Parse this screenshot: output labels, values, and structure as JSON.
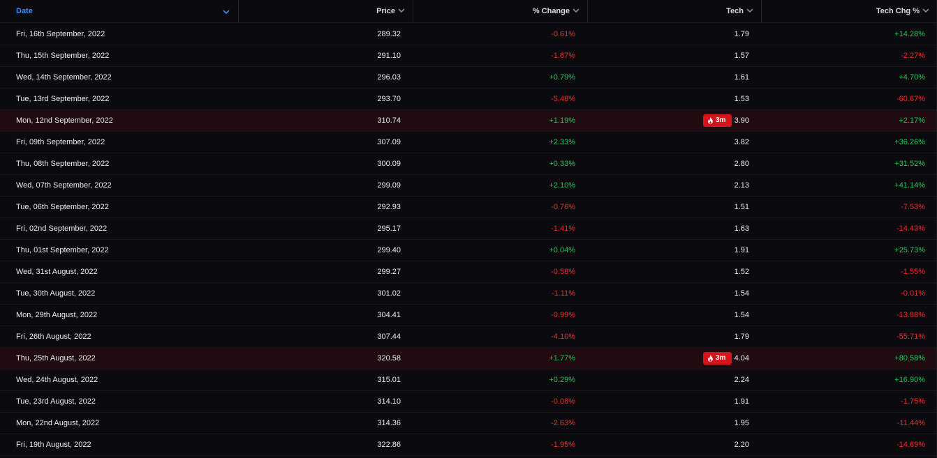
{
  "header": {
    "columns": [
      {
        "label": "Date",
        "active": true
      },
      {
        "label": "Price",
        "active": false
      },
      {
        "label": "% Change",
        "active": false
      },
      {
        "label": "Tech",
        "active": false
      },
      {
        "label": "Tech Chg %",
        "active": false
      }
    ]
  },
  "colors": {
    "positive": "#22c55e",
    "negative": "#ef2b2b",
    "badge": "#d7141b",
    "active_header": "#3b8ef0",
    "highlight_row": "#1f0b10"
  },
  "rows": [
    {
      "date": "Fri, 16th September, 2022",
      "price": "289.32",
      "change": "-0.61%",
      "tech": "1.79",
      "tech_chg": "+14.28%"
    },
    {
      "date": "Thu, 15th September, 2022",
      "price": "291.10",
      "change": "-1.67%",
      "tech": "1.57",
      "tech_chg": "-2.27%"
    },
    {
      "date": "Wed, 14th September, 2022",
      "price": "296.03",
      "change": "+0.79%",
      "tech": "1.61",
      "tech_chg": "+4.70%"
    },
    {
      "date": "Tue, 13rd September, 2022",
      "price": "293.70",
      "change": "-5.48%",
      "tech": "1.53",
      "tech_chg": "-60.67%"
    },
    {
      "date": "Mon, 12nd September, 2022",
      "price": "310.74",
      "change": "+1.19%",
      "tech": "3.90",
      "tech_chg": "+2.17%",
      "badge": "3m",
      "badge_icon": "fire-icon",
      "highlight": true
    },
    {
      "date": "Fri, 09th September, 2022",
      "price": "307.09",
      "change": "+2.33%",
      "tech": "3.82",
      "tech_chg": "+36.26%"
    },
    {
      "date": "Thu, 08th September, 2022",
      "price": "300.09",
      "change": "+0.33%",
      "tech": "2.80",
      "tech_chg": "+31.52%"
    },
    {
      "date": "Wed, 07th September, 2022",
      "price": "299.09",
      "change": "+2.10%",
      "tech": "2.13",
      "tech_chg": "+41.14%"
    },
    {
      "date": "Tue, 06th September, 2022",
      "price": "292.93",
      "change": "-0.76%",
      "tech": "1.51",
      "tech_chg": "-7.53%"
    },
    {
      "date": "Fri, 02nd September, 2022",
      "price": "295.17",
      "change": "-1.41%",
      "tech": "1.63",
      "tech_chg": "-14.43%"
    },
    {
      "date": "Thu, 01st September, 2022",
      "price": "299.40",
      "change": "+0.04%",
      "tech": "1.91",
      "tech_chg": "+25.73%"
    },
    {
      "date": "Wed, 31st August, 2022",
      "price": "299.27",
      "change": "-0.58%",
      "tech": "1.52",
      "tech_chg": "-1.55%"
    },
    {
      "date": "Tue, 30th August, 2022",
      "price": "301.02",
      "change": "-1.11%",
      "tech": "1.54",
      "tech_chg": "-0.01%"
    },
    {
      "date": "Mon, 29th August, 2022",
      "price": "304.41",
      "change": "-0.99%",
      "tech": "1.54",
      "tech_chg": "-13.88%"
    },
    {
      "date": "Fri, 26th August, 2022",
      "price": "307.44",
      "change": "-4.10%",
      "tech": "1.79",
      "tech_chg": "-55.71%"
    },
    {
      "date": "Thu, 25th August, 2022",
      "price": "320.58",
      "change": "+1.77%",
      "tech": "4.04",
      "tech_chg": "+80.58%",
      "badge": "3m",
      "badge_icon": "fire-icon",
      "highlight": true
    },
    {
      "date": "Wed, 24th August, 2022",
      "price": "315.01",
      "change": "+0.29%",
      "tech": "2.24",
      "tech_chg": "+16.90%"
    },
    {
      "date": "Tue, 23rd August, 2022",
      "price": "314.10",
      "change": "-0.08%",
      "tech": "1.91",
      "tech_chg": "-1.75%"
    },
    {
      "date": "Mon, 22nd August, 2022",
      "price": "314.36",
      "change": "-2.63%",
      "tech": "1.95",
      "tech_chg": "-11.44%"
    },
    {
      "date": "Fri, 19th August, 2022",
      "price": "322.86",
      "change": "-1.95%",
      "tech": "2.20",
      "tech_chg": "-14.69%"
    }
  ]
}
